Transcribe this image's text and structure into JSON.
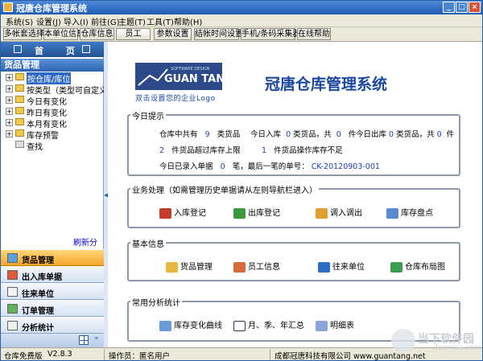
{
  "window": {
    "title": "冠唐仓库管理系统"
  },
  "menu": [
    "系统(S)",
    "设置(J)",
    "导入(I)",
    "前往(G)",
    "主题(T)",
    "工具(T)",
    "帮助(H)"
  ],
  "toolbar": [
    "多帐套选择",
    "本单位信息",
    "仓库信息",
    "员工",
    "参数设置",
    "结帐时间设置",
    "手机/条码采集器 ▾",
    "在线帮助"
  ],
  "left": {
    "home": "首 页",
    "goods_header": "货品管理",
    "tree": [
      {
        "label": "按仓库/库位",
        "selected": true,
        "expand": true
      },
      {
        "label": "按类型（类型可自定义）",
        "selected": false,
        "expand": true
      },
      {
        "label": "今日有变化",
        "selected": false,
        "expand": true
      },
      {
        "label": "昨日有变化",
        "selected": false,
        "expand": true
      },
      {
        "label": "本月有变化",
        "selected": false,
        "expand": true
      },
      {
        "label": "库存预警",
        "selected": false,
        "expand": true
      },
      {
        "label": "查找",
        "selected": false,
        "expand": false
      }
    ],
    "refresh": "刷新分类",
    "nav": [
      {
        "label": "货品管理",
        "active": true
      },
      {
        "label": "出入库单据",
        "active": false
      },
      {
        "label": "往来单位",
        "active": false
      },
      {
        "label": "订单管理",
        "active": false
      },
      {
        "label": "分析统计",
        "active": false
      }
    ]
  },
  "main": {
    "logo_text": "GUAN TANG",
    "logo_sub": "SOFTWARE DESIGN",
    "slogan": "双击设置您的企业Logo",
    "title": "冠唐仓库管理系统",
    "today": {
      "legend": "今日提示",
      "r1a_pre": "仓库中共有",
      "r1a_num": "9",
      "r1a_suf": "类货品",
      "r1b_pre": "今日入库",
      "r1b_n1": "0",
      "r1b_mid": "类货品，共",
      "r1b_n2": "0",
      "r1b_suf": "件",
      "r1c_pre": "今日出库",
      "r1c_n1": "0",
      "r1c_mid": "类货品，共",
      "r1c_n2": "0",
      "r1c_suf": "件",
      "r2a_num": "2",
      "r2a_suf": "件货品超过库存上限",
      "r2b_num": "1",
      "r2b_suf": "件货品操作库存不足",
      "r3_pre": "今日已录入单据",
      "r3_num": "0",
      "r3_mid": "笔，最后一笔的单号：",
      "r3_code": "CK-20120903-001"
    },
    "business": {
      "legend": "业务处理（如需管理历史单据请从左则导航栏进入）",
      "items": [
        "入库登记",
        "出库登记",
        "调入调出",
        "库存盘点"
      ]
    },
    "basic": {
      "legend": "基本信息",
      "items": [
        "货品管理",
        "员工信息",
        "往来单位",
        "仓库布局图"
      ]
    },
    "analysis": {
      "legend": "常用分析统计",
      "items": [
        "库存变化曲线",
        "月、季、年汇总",
        "明细表"
      ]
    }
  },
  "status": {
    "edition": "仓库免费版",
    "version": "V2.8.3",
    "operator_label": "操作员：",
    "operator": "匿名用户",
    "company": "成都冠唐科技有限公司 www.guantang.net"
  },
  "watermark": {
    "title": "当下软件园",
    "sub": "downxia.com"
  }
}
